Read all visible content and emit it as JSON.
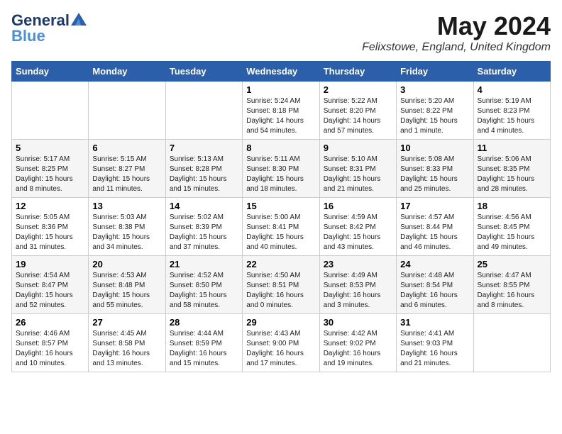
{
  "header": {
    "logo_line1": "General",
    "logo_line2": "Blue",
    "main_title": "May 2024",
    "subtitle": "Felixstowe, England, United Kingdom"
  },
  "calendar": {
    "days_of_week": [
      "Sunday",
      "Monday",
      "Tuesday",
      "Wednesday",
      "Thursday",
      "Friday",
      "Saturday"
    ],
    "weeks": [
      [
        {
          "day": "",
          "info": ""
        },
        {
          "day": "",
          "info": ""
        },
        {
          "day": "",
          "info": ""
        },
        {
          "day": "1",
          "info": "Sunrise: 5:24 AM\nSunset: 8:18 PM\nDaylight: 14 hours\nand 54 minutes."
        },
        {
          "day": "2",
          "info": "Sunrise: 5:22 AM\nSunset: 8:20 PM\nDaylight: 14 hours\nand 57 minutes."
        },
        {
          "day": "3",
          "info": "Sunrise: 5:20 AM\nSunset: 8:22 PM\nDaylight: 15 hours\nand 1 minute."
        },
        {
          "day": "4",
          "info": "Sunrise: 5:19 AM\nSunset: 8:23 PM\nDaylight: 15 hours\nand 4 minutes."
        }
      ],
      [
        {
          "day": "5",
          "info": "Sunrise: 5:17 AM\nSunset: 8:25 PM\nDaylight: 15 hours\nand 8 minutes."
        },
        {
          "day": "6",
          "info": "Sunrise: 5:15 AM\nSunset: 8:27 PM\nDaylight: 15 hours\nand 11 minutes."
        },
        {
          "day": "7",
          "info": "Sunrise: 5:13 AM\nSunset: 8:28 PM\nDaylight: 15 hours\nand 15 minutes."
        },
        {
          "day": "8",
          "info": "Sunrise: 5:11 AM\nSunset: 8:30 PM\nDaylight: 15 hours\nand 18 minutes."
        },
        {
          "day": "9",
          "info": "Sunrise: 5:10 AM\nSunset: 8:31 PM\nDaylight: 15 hours\nand 21 minutes."
        },
        {
          "day": "10",
          "info": "Sunrise: 5:08 AM\nSunset: 8:33 PM\nDaylight: 15 hours\nand 25 minutes."
        },
        {
          "day": "11",
          "info": "Sunrise: 5:06 AM\nSunset: 8:35 PM\nDaylight: 15 hours\nand 28 minutes."
        }
      ],
      [
        {
          "day": "12",
          "info": "Sunrise: 5:05 AM\nSunset: 8:36 PM\nDaylight: 15 hours\nand 31 minutes."
        },
        {
          "day": "13",
          "info": "Sunrise: 5:03 AM\nSunset: 8:38 PM\nDaylight: 15 hours\nand 34 minutes."
        },
        {
          "day": "14",
          "info": "Sunrise: 5:02 AM\nSunset: 8:39 PM\nDaylight: 15 hours\nand 37 minutes."
        },
        {
          "day": "15",
          "info": "Sunrise: 5:00 AM\nSunset: 8:41 PM\nDaylight: 15 hours\nand 40 minutes."
        },
        {
          "day": "16",
          "info": "Sunrise: 4:59 AM\nSunset: 8:42 PM\nDaylight: 15 hours\nand 43 minutes."
        },
        {
          "day": "17",
          "info": "Sunrise: 4:57 AM\nSunset: 8:44 PM\nDaylight: 15 hours\nand 46 minutes."
        },
        {
          "day": "18",
          "info": "Sunrise: 4:56 AM\nSunset: 8:45 PM\nDaylight: 15 hours\nand 49 minutes."
        }
      ],
      [
        {
          "day": "19",
          "info": "Sunrise: 4:54 AM\nSunset: 8:47 PM\nDaylight: 15 hours\nand 52 minutes."
        },
        {
          "day": "20",
          "info": "Sunrise: 4:53 AM\nSunset: 8:48 PM\nDaylight: 15 hours\nand 55 minutes."
        },
        {
          "day": "21",
          "info": "Sunrise: 4:52 AM\nSunset: 8:50 PM\nDaylight: 15 hours\nand 58 minutes."
        },
        {
          "day": "22",
          "info": "Sunrise: 4:50 AM\nSunset: 8:51 PM\nDaylight: 16 hours\nand 0 minutes."
        },
        {
          "day": "23",
          "info": "Sunrise: 4:49 AM\nSunset: 8:53 PM\nDaylight: 16 hours\nand 3 minutes."
        },
        {
          "day": "24",
          "info": "Sunrise: 4:48 AM\nSunset: 8:54 PM\nDaylight: 16 hours\nand 6 minutes."
        },
        {
          "day": "25",
          "info": "Sunrise: 4:47 AM\nSunset: 8:55 PM\nDaylight: 16 hours\nand 8 minutes."
        }
      ],
      [
        {
          "day": "26",
          "info": "Sunrise: 4:46 AM\nSunset: 8:57 PM\nDaylight: 16 hours\nand 10 minutes."
        },
        {
          "day": "27",
          "info": "Sunrise: 4:45 AM\nSunset: 8:58 PM\nDaylight: 16 hours\nand 13 minutes."
        },
        {
          "day": "28",
          "info": "Sunrise: 4:44 AM\nSunset: 8:59 PM\nDaylight: 16 hours\nand 15 minutes."
        },
        {
          "day": "29",
          "info": "Sunrise: 4:43 AM\nSunset: 9:00 PM\nDaylight: 16 hours\nand 17 minutes."
        },
        {
          "day": "30",
          "info": "Sunrise: 4:42 AM\nSunset: 9:02 PM\nDaylight: 16 hours\nand 19 minutes."
        },
        {
          "day": "31",
          "info": "Sunrise: 4:41 AM\nSunset: 9:03 PM\nDaylight: 16 hours\nand 21 minutes."
        },
        {
          "day": "",
          "info": ""
        }
      ]
    ]
  }
}
